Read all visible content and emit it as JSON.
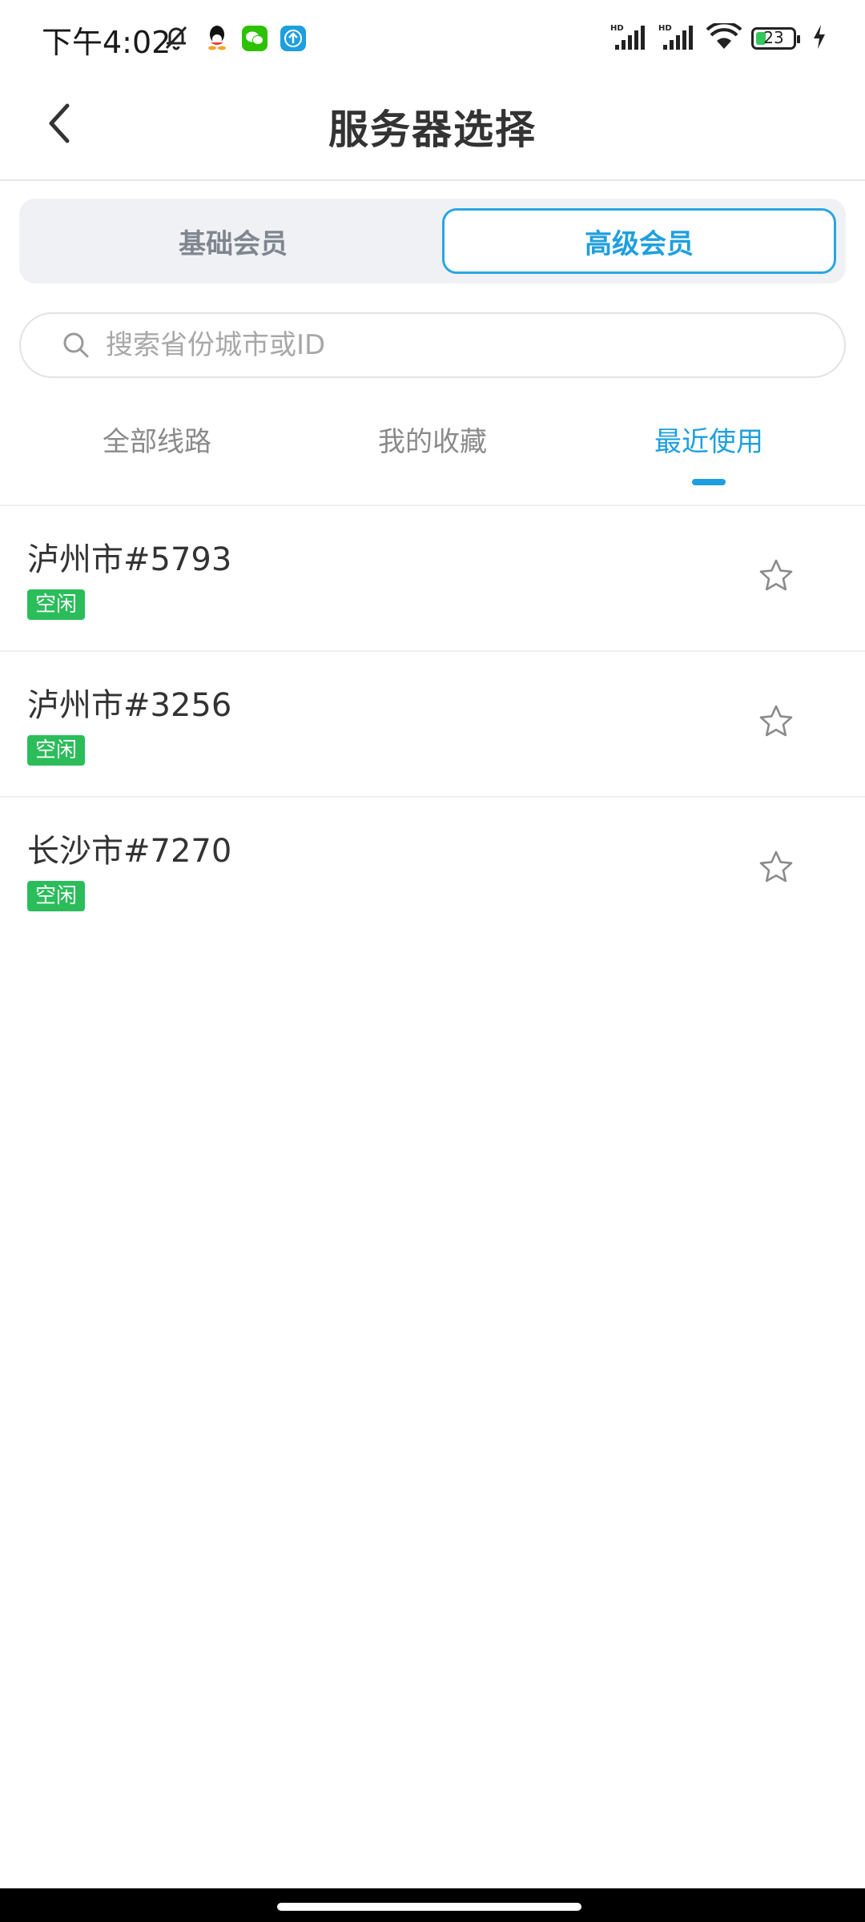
{
  "status_bar": {
    "time": "下午4:02",
    "left_icons": [
      "mute-bell-icon",
      "qq-icon",
      "wechat-icon",
      "upload-app-icon"
    ],
    "right_icons": [
      "hd-signal-icon",
      "hd-signal-icon",
      "wifi-icon",
      "battery-icon",
      "charging-icon"
    ],
    "battery_level": "23"
  },
  "header": {
    "title": "服务器选择",
    "back_icon": "chevron-left-icon"
  },
  "member_tabs": {
    "items": [
      {
        "label": "基础会员",
        "selected": false
      },
      {
        "label": "高级会员",
        "selected": true
      }
    ]
  },
  "search": {
    "placeholder": "搜索省份城市或ID",
    "value": ""
  },
  "line_tabs": {
    "items": [
      {
        "label": "全部线路",
        "active": false
      },
      {
        "label": "我的收藏",
        "active": false
      },
      {
        "label": "最近使用",
        "active": true
      }
    ]
  },
  "servers": [
    {
      "name": "泸州市#5793",
      "status": "空闲",
      "favorite": false
    },
    {
      "name": "泸州市#3256",
      "status": "空闲",
      "favorite": false
    },
    {
      "name": "长沙市#7270",
      "status": "空闲",
      "favorite": false
    }
  ],
  "colors": {
    "accent": "#1e9fde",
    "status_idle": "#2bbd5a",
    "segment_bg": "#eff1f4"
  }
}
